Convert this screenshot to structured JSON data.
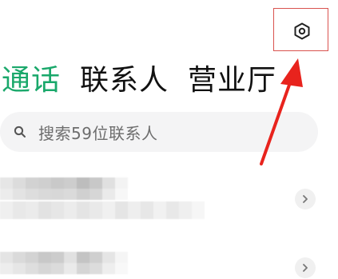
{
  "tabs": [
    {
      "label": "通话",
      "active": true
    },
    {
      "label": "联系人",
      "active": false
    },
    {
      "label": "营业厅",
      "active": false
    }
  ],
  "search": {
    "placeholder": "搜索59位联系人",
    "icon": "search-icon"
  },
  "header": {
    "settings_icon": "settings-icon"
  },
  "contacts": [
    {
      "name": "",
      "detail": "",
      "blurred": true
    },
    {
      "name": "",
      "detail": "",
      "blurred": true
    }
  ],
  "annotation": {
    "highlight_color": "#d9534f",
    "arrow_color": "#e8231d"
  },
  "colors": {
    "accent": "#1aa86b",
    "text": "#111111",
    "search_bg": "#f4f4f5",
    "search_text": "#6d6d6d"
  }
}
